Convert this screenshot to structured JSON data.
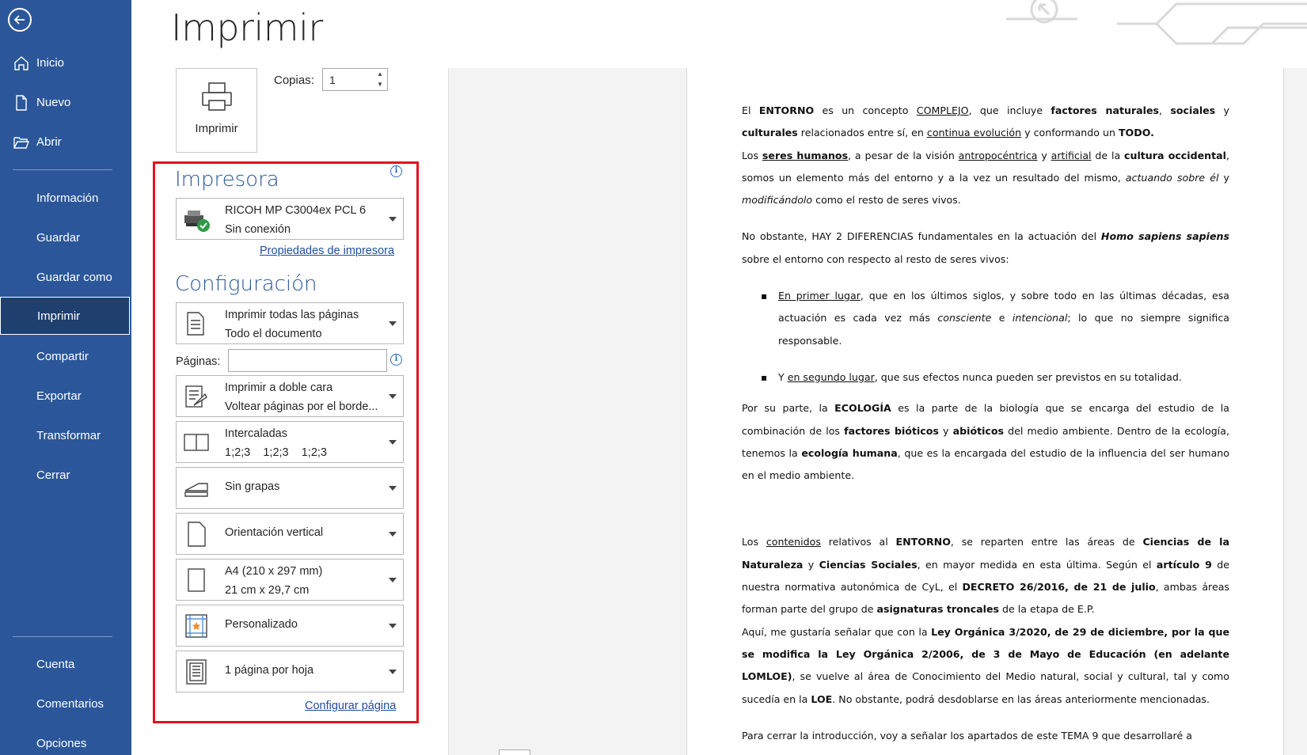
{
  "sidebar": {
    "items": [
      {
        "label": "Inicio"
      },
      {
        "label": "Nuevo"
      },
      {
        "label": "Abrir"
      },
      {
        "label": "Información"
      },
      {
        "label": "Guardar"
      },
      {
        "label": "Guardar como"
      },
      {
        "label": "Imprimir"
      },
      {
        "label": "Compartir"
      },
      {
        "label": "Exportar"
      },
      {
        "label": "Transformar"
      },
      {
        "label": "Cerrar"
      },
      {
        "label": "Cuenta"
      },
      {
        "label": "Comentarios"
      },
      {
        "label": "Opciones"
      }
    ],
    "active": "Imprimir"
  },
  "page_title": "Imprimir",
  "print_button": {
    "label": "Imprimir"
  },
  "copies": {
    "label": "Copias:",
    "value": "1"
  },
  "printer": {
    "heading": "Impresora",
    "name": "RICOH MP C3004ex PCL 6",
    "status": "Sin conexión",
    "properties_link": "Propiedades de impresora"
  },
  "settings": {
    "heading": "Configuración",
    "range": {
      "line1": "Imprimir todas las páginas",
      "line2": "Todo el documento"
    },
    "pages_label": "Páginas:",
    "pages_value": "",
    "duplex": {
      "line1": "Imprimir a doble cara",
      "line2": "Voltear páginas por el borde..."
    },
    "collate": {
      "line1": "Intercaladas",
      "line2": "1;2;3    1;2;3    1;2;3"
    },
    "staple": {
      "label": "Sin grapas"
    },
    "orientation": {
      "label": "Orientación vertical"
    },
    "paper": {
      "line1": "A4 (210 x 297 mm)",
      "line2": "21 cm x 29,7 cm"
    },
    "margins": {
      "label": "Personalizado"
    },
    "per_sheet": {
      "label": "1 página por hoja"
    },
    "page_setup_link": "Configurar página"
  },
  "highlight_color": "#e0141e",
  "accent_color": "#2b579a",
  "document": {
    "p1": [
      {
        "t": "El "
      },
      {
        "t": "ENTORNO",
        "b": true
      },
      {
        "t": " es un concepto "
      },
      {
        "t": "COMPLEJO",
        "u": true
      },
      {
        "t": ", que incluye "
      },
      {
        "t": "factores naturales",
        "b": true
      },
      {
        "t": ", "
      },
      {
        "t": "sociales",
        "b": true
      },
      {
        "t": " y "
      },
      {
        "t": "culturales",
        "b": true
      },
      {
        "t": " relacionados entre sí, en "
      },
      {
        "t": "continua evolución",
        "u": true
      },
      {
        "t": " y conformando un "
      },
      {
        "t": "TODO.",
        "b": true
      }
    ],
    "p2": [
      {
        "t": "Los "
      },
      {
        "t": "seres humanos",
        "b": true,
        "u": true
      },
      {
        "t": ", a pesar de la visión "
      },
      {
        "t": "antropocéntrica",
        "u": true
      },
      {
        "t": " y "
      },
      {
        "t": "artificial",
        "u": true
      },
      {
        "t": " de la "
      },
      {
        "t": "cultura occidental",
        "b": true
      },
      {
        "t": ", somos un elemento más del entorno y a la vez un resultado del mismo, "
      },
      {
        "t": "actuando sobre él",
        "i": true
      },
      {
        "t": " y "
      },
      {
        "t": "modificándolo",
        "i": true
      },
      {
        "t": " como el resto de seres vivos."
      }
    ],
    "p3": [
      {
        "t": "No obstante, HAY 2 DIFERENCIAS fundamentales en la actuación del "
      },
      {
        "t": "Homo sapiens sapiens",
        "b": true,
        "i": true
      },
      {
        "t": " sobre el entorno con respecto al resto de seres vivos:"
      }
    ],
    "li1": [
      {
        "t": "En primer lugar",
        "u": true
      },
      {
        "t": ", que en los últimos siglos, y sobre todo en las últimas décadas, esa actuación es cada vez más "
      },
      {
        "t": "consciente",
        "i": true
      },
      {
        "t": " e "
      },
      {
        "t": "intencional",
        "i": true
      },
      {
        "t": "; lo que no siempre significa responsable."
      }
    ],
    "li2": [
      {
        "t": "Y "
      },
      {
        "t": "en segundo lugar",
        "u": true
      },
      {
        "t": ", que sus efectos nunca pueden ser previstos en su totalidad."
      }
    ],
    "p4": [
      {
        "t": "Por su parte, la "
      },
      {
        "t": "ECOLOGÍA",
        "b": true
      },
      {
        "t": " es la parte de la biología que se encarga del estudio de la combinación de los "
      },
      {
        "t": "factores bióticos",
        "b": true
      },
      {
        "t": " y "
      },
      {
        "t": "abióticos",
        "b": true
      },
      {
        "t": " del medio ambiente. Dentro de la ecología, tenemos la "
      },
      {
        "t": "ecología humana",
        "b": true
      },
      {
        "t": ", que es la encargada del estudio de la influencia del ser humano en el medio ambiente."
      }
    ],
    "p5": [
      {
        "t": "Los "
      },
      {
        "t": "contenidos",
        "u": true
      },
      {
        "t": " relativos al "
      },
      {
        "t": "ENTORNO",
        "b": true
      },
      {
        "t": ", se reparten entre las áreas de "
      },
      {
        "t": "Ciencias de la Naturaleza",
        "b": true
      },
      {
        "t": " y "
      },
      {
        "t": "Ciencias Sociales",
        "b": true
      },
      {
        "t": ", en mayor medida en esta última. Según el "
      },
      {
        "t": "artículo 9",
        "b": true
      },
      {
        "t": " de nuestra normativa autonómica de CyL, el "
      },
      {
        "t": "DECRETO 26/2016, de 21 de julio",
        "b": true
      },
      {
        "t": ", ambas áreas forman parte del grupo de "
      },
      {
        "t": "asignaturas troncales",
        "b": true
      },
      {
        "t": " de la etapa de E.P."
      }
    ],
    "p6": [
      {
        "t": "Aquí, me gustaría señalar que con la "
      },
      {
        "t": "Ley Orgánica 3/2020, de 29 de diciembre, por la que se modifica la Ley Orgánica 2/2006, de 3 de Mayo de Educación (en adelante LOMLOE)",
        "b": true
      },
      {
        "t": ", se vuelve al área de Conocimiento del Medio natural, social y cultural, tal y como sucedía en la "
      },
      {
        "t": "LOE",
        "b": true
      },
      {
        "t": ". No obstante, podrá desdoblarse en las áreas anteriormente mencionadas."
      }
    ],
    "p7": [
      {
        "t": "Para cerrar la introducción, voy a señalar los apartados de este TEMA 9 que desarrollaré a"
      }
    ]
  }
}
